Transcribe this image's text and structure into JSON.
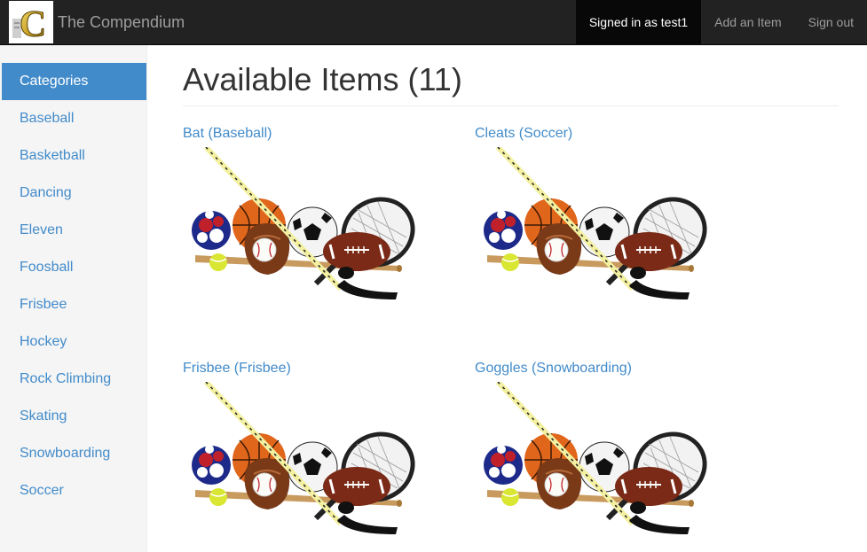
{
  "navbar": {
    "brand": "The Compendium",
    "logo_letter": "C",
    "signed_in": "Signed in as test1",
    "add_item": "Add an Item",
    "sign_out": "Sign out"
  },
  "sidebar": {
    "header": "Categories",
    "items": [
      {
        "label": "Baseball"
      },
      {
        "label": "Basketball"
      },
      {
        "label": "Dancing"
      },
      {
        "label": "Eleven"
      },
      {
        "label": "Foosball"
      },
      {
        "label": "Frisbee"
      },
      {
        "label": "Hockey"
      },
      {
        "label": "Rock Climbing"
      },
      {
        "label": "Skating"
      },
      {
        "label": "Snowboarding"
      },
      {
        "label": "Soccer"
      }
    ]
  },
  "main": {
    "title": "Available Items (11)",
    "items": [
      {
        "label": "Bat (Baseball)"
      },
      {
        "label": "Cleats (Soccer)"
      },
      {
        "label": "Frisbee (Frisbee)"
      },
      {
        "label": "Goggles (Snowboarding)"
      }
    ]
  },
  "colors": {
    "navbar_bg": "#222222",
    "link": "#428bca",
    "sidebar_bg": "#f5f5f5"
  }
}
